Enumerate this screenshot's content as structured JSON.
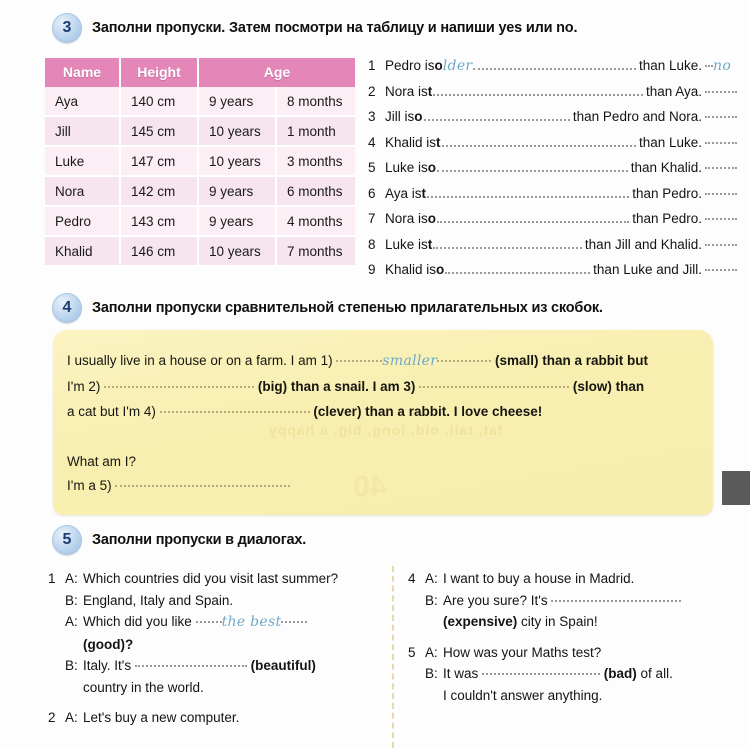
{
  "exercise3": {
    "number": "3",
    "title": "Заполни пропуски. Затем посмотри на таблицу и напиши yes или no.",
    "table": {
      "headers": [
        "Name",
        "Height",
        "Age"
      ],
      "rows": [
        {
          "name": "Aya",
          "height": "140 cm",
          "years": "9 years",
          "months": "8 months"
        },
        {
          "name": "Jill",
          "height": "145 cm",
          "years": "10 years",
          "months": "1 month"
        },
        {
          "name": "Luke",
          "height": "147 cm",
          "years": "10 years",
          "months": "3 months"
        },
        {
          "name": "Nora",
          "height": "142 cm",
          "years": "9 years",
          "months": "6 months"
        },
        {
          "name": "Pedro",
          "height": "143 cm",
          "years": "9 years",
          "months": "4 months"
        },
        {
          "name": "Khalid",
          "height": "146 cm",
          "years": "10 years",
          "months": "7 months"
        }
      ]
    },
    "sentences": [
      {
        "no": "1",
        "before": "Pedro is ",
        "hint": "o",
        "answer": "lder",
        "after": " than Luke.",
        "tail": "no"
      },
      {
        "no": "2",
        "before": "Nora is ",
        "hint": "t",
        "answer": "",
        "after": " than Aya.",
        "tail": ""
      },
      {
        "no": "3",
        "before": "Jill is ",
        "hint": "o",
        "answer": "",
        "after": " than Pedro and Nora.",
        "tail": ""
      },
      {
        "no": "4",
        "before": "Khalid is ",
        "hint": "t",
        "answer": "",
        "after": " than Luke.",
        "tail": ""
      },
      {
        "no": "5",
        "before": "Luke is ",
        "hint": "o",
        "answer": "",
        "after": " than Khalid.",
        "tail": ""
      },
      {
        "no": "6",
        "before": "Aya is ",
        "hint": "t",
        "answer": "",
        "after": " than Pedro.",
        "tail": ""
      },
      {
        "no": "7",
        "before": "Nora is ",
        "hint": "o",
        "answer": "",
        "after": " than Pedro.",
        "tail": ""
      },
      {
        "no": "8",
        "before": "Luke is ",
        "hint": "t",
        "answer": "",
        "after": " than Jill and Khalid.",
        "tail": ""
      },
      {
        "no": "9",
        "before": "Khalid is ",
        "hint": "o",
        "answer": "",
        "after": " than Luke and Jill.",
        "tail": ""
      }
    ]
  },
  "exercise4": {
    "number": "4",
    "title": "Заполни пропуски сравнительной степенью прилагательных из скобок.",
    "riddle": {
      "p1_a": "I usually live in a house or on a farm. I am 1)",
      "p1_answer": "smaller",
      "p1_b": "(small) than a rabbit but",
      "p2_a": "I'm 2)",
      "p2_b": "(big) than a snail. I am 3)",
      "p2_c": "(slow) than",
      "p3_a": "a cat but I'm 4)",
      "p3_b": "(clever) than a rabbit. I love cheese!",
      "question": "What am I?",
      "answer_line": "I'm a 5)",
      "bleed_text": "fat, tall, old, long, big, a happy",
      "bleed_text2": "40"
    }
  },
  "exercise5": {
    "number": "5",
    "title": "Заполни пропуски в диалогах.",
    "dialogues_left": [
      {
        "no": "1",
        "lines": [
          {
            "speaker": "A:",
            "text": "Which countries did you visit last summer?",
            "type": "plain"
          },
          {
            "speaker": "B:",
            "text": "England, Italy and Spain.",
            "type": "plain"
          },
          {
            "speaker": "A:",
            "before": "Which did you like",
            "answer": "the best",
            "after": "",
            "type": "gap-hand"
          },
          {
            "speaker": "",
            "text": "(good)?",
            "type": "bold"
          },
          {
            "speaker": "B:",
            "before": "Italy. It's",
            "after": "(beautiful)",
            "type": "gap"
          },
          {
            "speaker": "",
            "text": "country in the world.",
            "type": "plain"
          }
        ]
      },
      {
        "no": "2",
        "lines": [
          {
            "speaker": "A:",
            "text": "Let's buy a new computer.",
            "type": "plain"
          }
        ]
      }
    ],
    "dialogues_right": [
      {
        "no": "4",
        "lines": [
          {
            "speaker": "A:",
            "text": "I want to buy a house in Madrid.",
            "type": "plain"
          },
          {
            "speaker": "B:",
            "before": "Are you sure? It's",
            "after": "",
            "type": "gap"
          },
          {
            "speaker": "",
            "text": "(expensive) city in Spain!",
            "type": "bold-lead"
          }
        ]
      },
      {
        "no": "5",
        "lines": [
          {
            "speaker": "A:",
            "text": "How was your Maths test?",
            "type": "plain"
          },
          {
            "speaker": "B:",
            "before": "It was",
            "after": "(bad) of all.",
            "type": "gap"
          },
          {
            "speaker": "",
            "text": "I couldn't answer anything.",
            "type": "plain"
          }
        ]
      }
    ]
  },
  "colors": {
    "table_header": "#e486b8",
    "table_row_odd": "#fbeef5",
    "table_row_even": "#f6e4ef",
    "riddle_bg": "#f8eeb0",
    "handwriting": "#6fa8c8",
    "circle_blue": "#9cc0e2"
  }
}
